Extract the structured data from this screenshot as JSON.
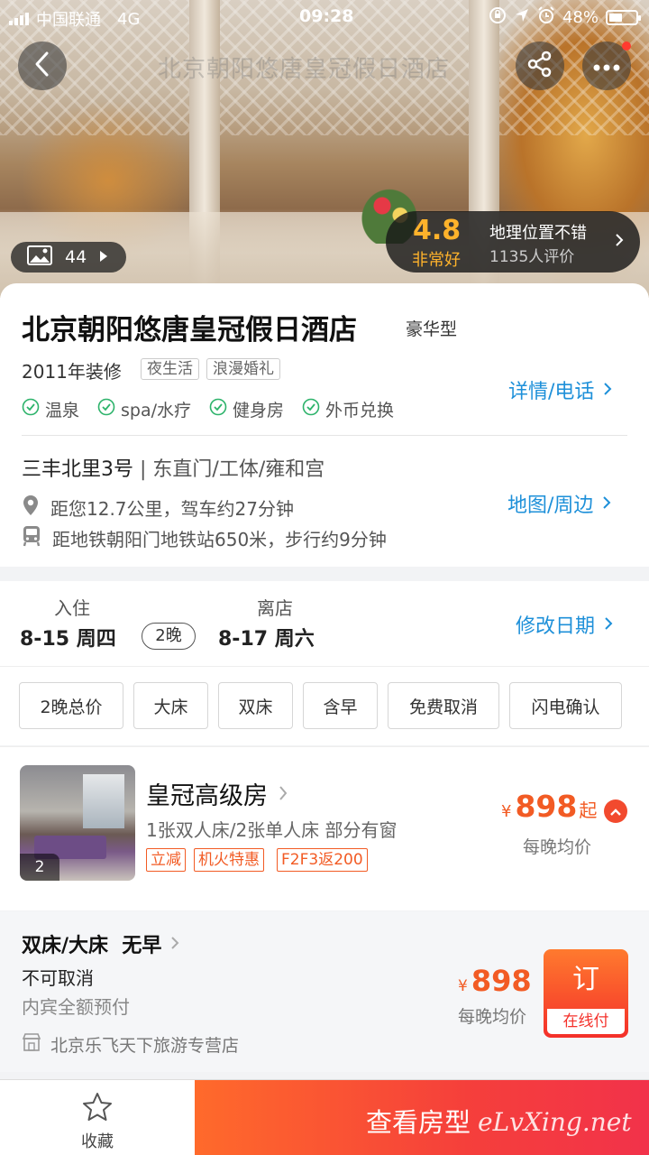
{
  "status_bar": {
    "carrier": "中国联通",
    "network": "4G",
    "time": "09:28",
    "battery": "48%"
  },
  "hero": {
    "watermark": "北京朝阳悠唐皇冠假日酒店",
    "photo_count": "44",
    "rating": {
      "score": "4.8",
      "score_text": "非常好",
      "location_text": "地理位置不错",
      "review_count": "1135人评价"
    }
  },
  "hotel": {
    "name": "北京朝阳悠唐皇冠假日酒店",
    "grade": "豪华型",
    "renovation": "2011年装修",
    "tags": [
      "夜生活",
      "浪漫婚礼"
    ],
    "facilities": [
      "温泉",
      "spa/水疗",
      "健身房",
      "外币兑换"
    ],
    "details_link": "详情/电话",
    "address": "三丰北里3号",
    "area": "东直门/工体/雍和宫",
    "distance": "距您12.7公里，驾车约27分钟",
    "metro": "距地铁朝阳门地铁站650米，步行约9分钟",
    "map_link": "地图/周边"
  },
  "dates": {
    "checkin_label": "入住",
    "checkin": "8-15 周四",
    "nights": "2晚",
    "checkout_label": "离店",
    "checkout": "8-17 周六",
    "modify_link": "修改日期"
  },
  "filters": [
    "2晚总价",
    "大床",
    "双床",
    "含早",
    "免费取消",
    "闪电确认"
  ],
  "room": {
    "name": "皇冠高级房",
    "photo_count": "2",
    "description": "1张双人床/2张单人床 部分有窗",
    "promos": [
      "立减",
      "机火特惠",
      "F2F3返200"
    ],
    "currency": "¥",
    "price": "898",
    "price_suffix": "起",
    "avg_label": "每晚均价"
  },
  "rate_plan": {
    "title": "双床/大床  无早",
    "cancel_policy": "不可取消",
    "payment": "内宾全额预付",
    "shop": "北京乐飞天下旅游专营店",
    "currency": "¥",
    "price": "898",
    "avg_label": "每晚均价",
    "book_label": "订",
    "book_sub_label": "在线付"
  },
  "bottom_bar": {
    "favorite_label": "收藏",
    "view_rooms_label": "查看房型",
    "watermark": "eLvXing.net"
  },
  "colors": {
    "accent_blue": "#1e90d9",
    "price_orange": "#f25b24",
    "rating_gold": "#ffb32b"
  }
}
